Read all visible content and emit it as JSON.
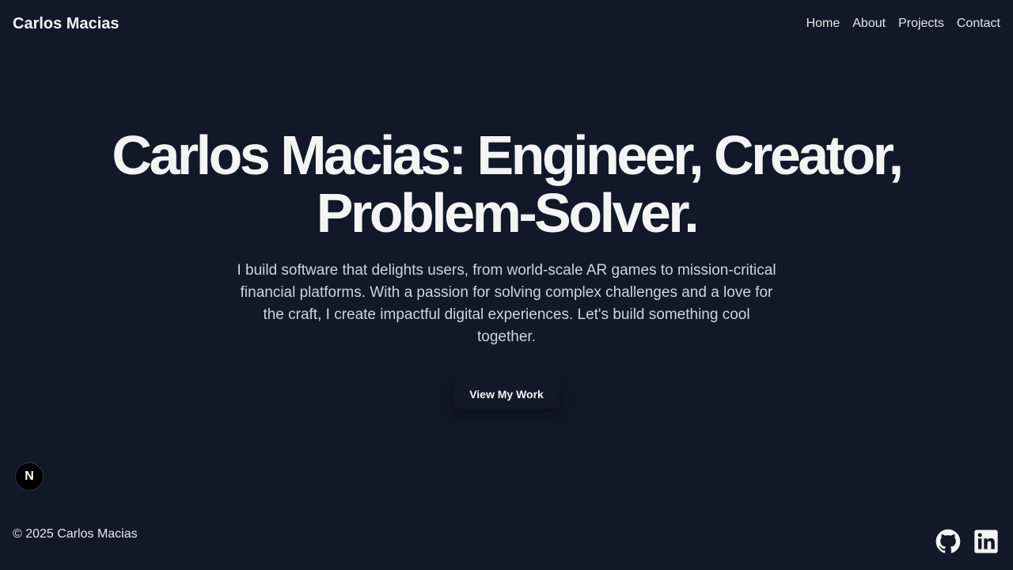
{
  "header": {
    "brand": "Carlos Macias",
    "nav": [
      "Home",
      "About",
      "Projects",
      "Contact"
    ]
  },
  "hero": {
    "title": "Carlos Macias: Engineer, Creator, Problem-Solver.",
    "description": "I build software that delights users, from world-scale AR games to mission-critical financial platforms. With a passion for solving complex challenges and a love for the craft, I create impactful digital experiences. Let's build something cool together.",
    "cta_label": "View My Work"
  },
  "footer": {
    "copyright": "© 2025 Carlos Macias",
    "badge": "N",
    "socials": [
      "github-icon",
      "linkedin-icon"
    ]
  },
  "colors": {
    "background": "#111827",
    "text": "#f3f4f6",
    "muted": "#cbd5e1"
  }
}
